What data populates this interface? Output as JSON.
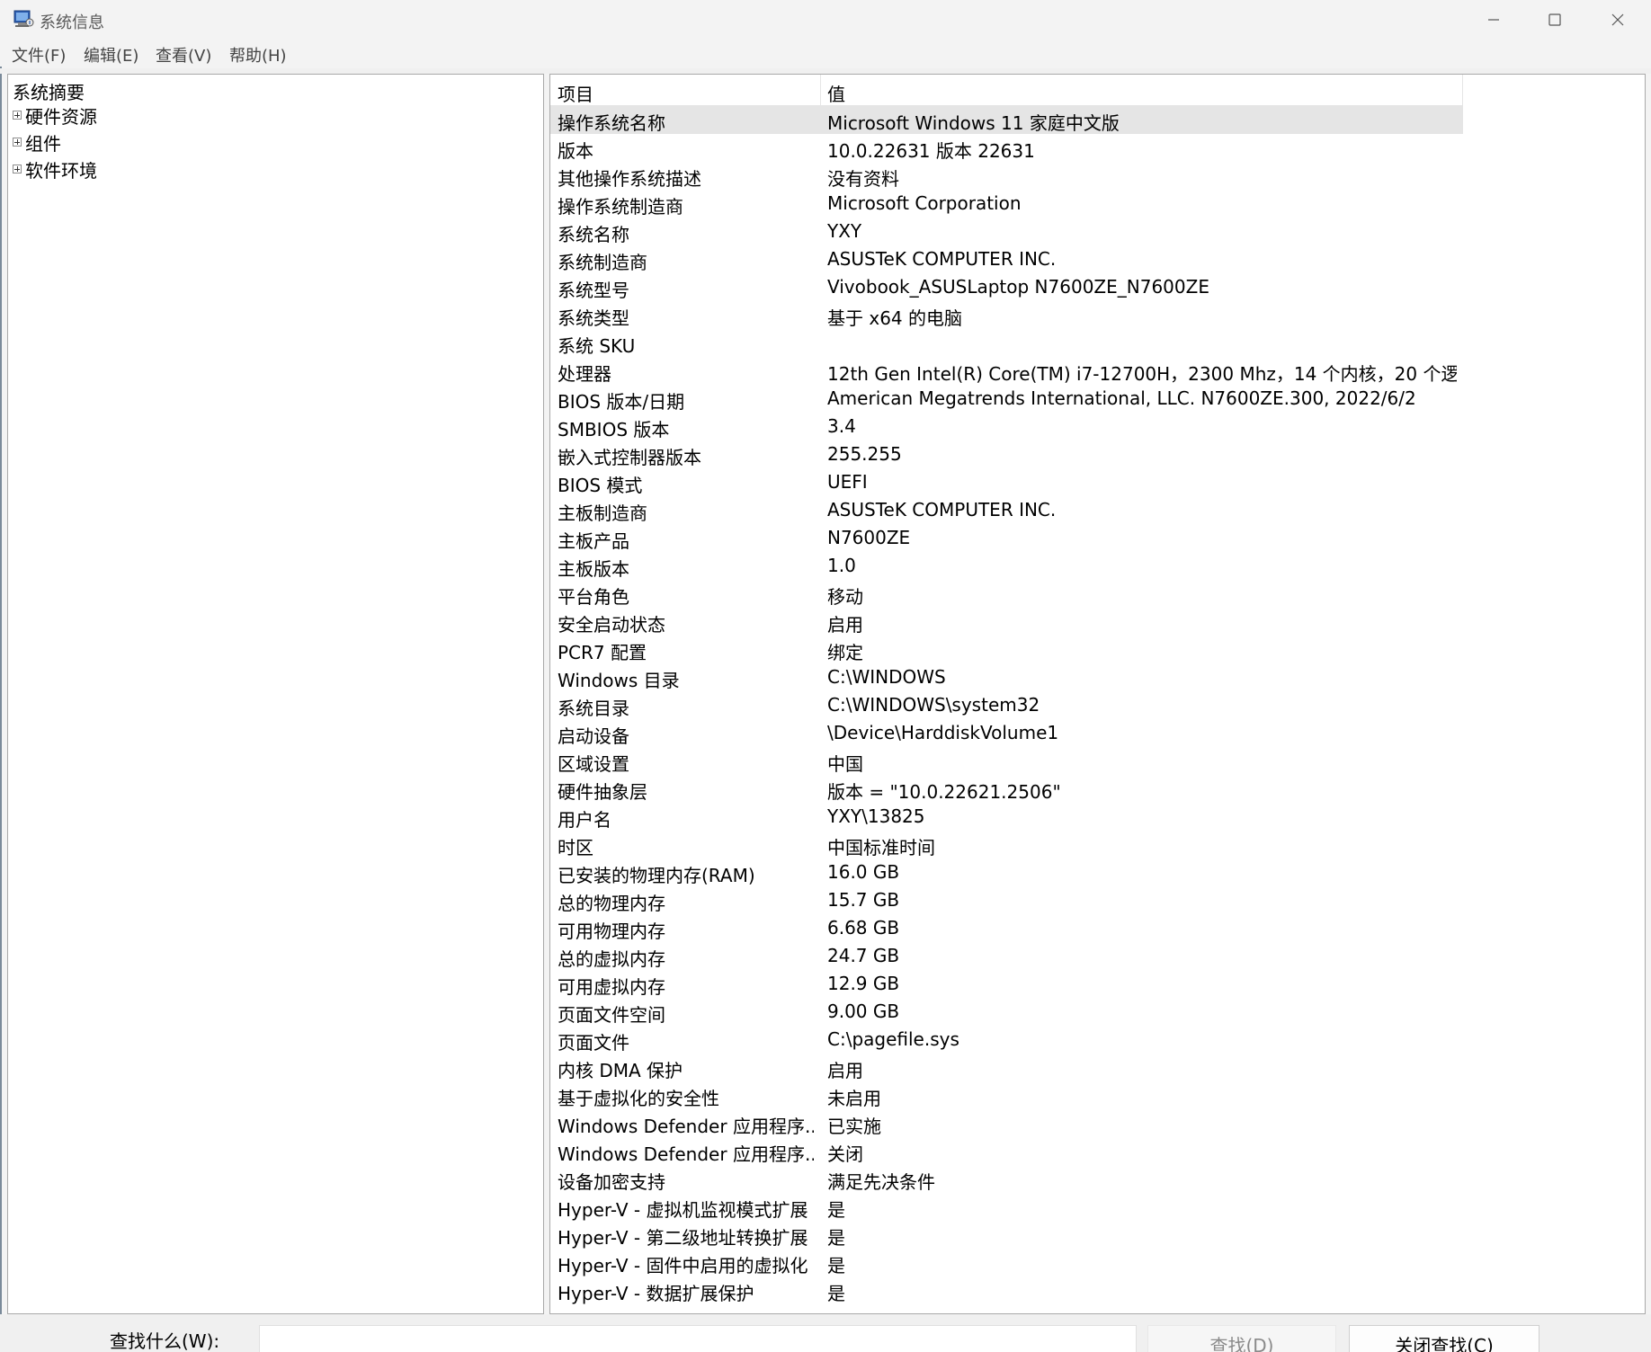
{
  "window": {
    "title": "系统信息",
    "icon": "system-info-icon",
    "controls": [
      "minimize-icon",
      "maximize-icon",
      "close-icon"
    ]
  },
  "menu": {
    "file": "文件(F)",
    "edit": "编辑(E)",
    "view": "查看(V)",
    "help": "帮助(H)"
  },
  "tree": {
    "root": "系统摘要",
    "nodes": [
      "硬件资源",
      "组件",
      "软件环境"
    ]
  },
  "list": {
    "columns": {
      "item": "项目",
      "value": "值"
    },
    "selected_index": 0,
    "rows": [
      {
        "item": "操作系统名称",
        "value": "Microsoft Windows 11 家庭中文版"
      },
      {
        "item": "版本",
        "value": "10.0.22631 版本 22631"
      },
      {
        "item": "其他操作系统描述",
        "value": "没有资料"
      },
      {
        "item": "操作系统制造商",
        "value": "Microsoft Corporation"
      },
      {
        "item": "系统名称",
        "value": "YXY"
      },
      {
        "item": "系统制造商",
        "value": "ASUSTeK COMPUTER INC."
      },
      {
        "item": "系统型号",
        "value": "Vivobook_ASUSLaptop N7600ZE_N7600ZE"
      },
      {
        "item": "系统类型",
        "value": "基于 x64 的电脑"
      },
      {
        "item": "系统 SKU",
        "value": ""
      },
      {
        "item": "处理器",
        "value": "12th Gen Intel(R) Core(TM) i7-12700H，2300 Mhz，14 个内核，20 个逻..."
      },
      {
        "item": "BIOS 版本/日期",
        "value": "American Megatrends International, LLC. N7600ZE.300, 2022/6/2"
      },
      {
        "item": "SMBIOS 版本",
        "value": "3.4"
      },
      {
        "item": "嵌入式控制器版本",
        "value": "255.255"
      },
      {
        "item": "BIOS 模式",
        "value": "UEFI"
      },
      {
        "item": "主板制造商",
        "value": "ASUSTeK COMPUTER INC."
      },
      {
        "item": "主板产品",
        "value": "N7600ZE"
      },
      {
        "item": "主板版本",
        "value": "1.0"
      },
      {
        "item": "平台角色",
        "value": "移动"
      },
      {
        "item": "安全启动状态",
        "value": "启用"
      },
      {
        "item": "PCR7 配置",
        "value": "绑定"
      },
      {
        "item": "Windows 目录",
        "value": "C:\\WINDOWS"
      },
      {
        "item": "系统目录",
        "value": "C:\\WINDOWS\\system32"
      },
      {
        "item": "启动设备",
        "value": "\\Device\\HarddiskVolume1"
      },
      {
        "item": "区域设置",
        "value": "中国"
      },
      {
        "item": "硬件抽象层",
        "value": "版本 = \"10.0.22621.2506\""
      },
      {
        "item": "用户名",
        "value": "YXY\\13825"
      },
      {
        "item": "时区",
        "value": "中国标准时间"
      },
      {
        "item": "已安装的物理内存(RAM)",
        "value": "16.0 GB"
      },
      {
        "item": "总的物理内存",
        "value": "15.7 GB"
      },
      {
        "item": "可用物理内存",
        "value": "6.68 GB"
      },
      {
        "item": "总的虚拟内存",
        "value": "24.7 GB"
      },
      {
        "item": "可用虚拟内存",
        "value": "12.9 GB"
      },
      {
        "item": "页面文件空间",
        "value": "9.00 GB"
      },
      {
        "item": "页面文件",
        "value": "C:\\pagefile.sys"
      },
      {
        "item": "内核 DMA 保护",
        "value": "启用"
      },
      {
        "item": "基于虚拟化的安全性",
        "value": "未启用"
      },
      {
        "item": "Windows Defender 应用程序...",
        "value": "已实施"
      },
      {
        "item": "Windows Defender 应用程序...",
        "value": "关闭"
      },
      {
        "item": "设备加密支持",
        "value": "满足先决条件"
      },
      {
        "item": "Hyper-V - 虚拟机监视模式扩展",
        "value": "是"
      },
      {
        "item": "Hyper-V - 第二级地址转换扩展",
        "value": "是"
      },
      {
        "item": "Hyper-V - 固件中启用的虚拟化",
        "value": "是"
      },
      {
        "item": "Hyper-V - 数据扩展保护",
        "value": "是"
      }
    ]
  },
  "find": {
    "label": "查找什么(W):",
    "value": "",
    "find_button": "查找(D)",
    "close_button": "关闭查找(C)"
  }
}
